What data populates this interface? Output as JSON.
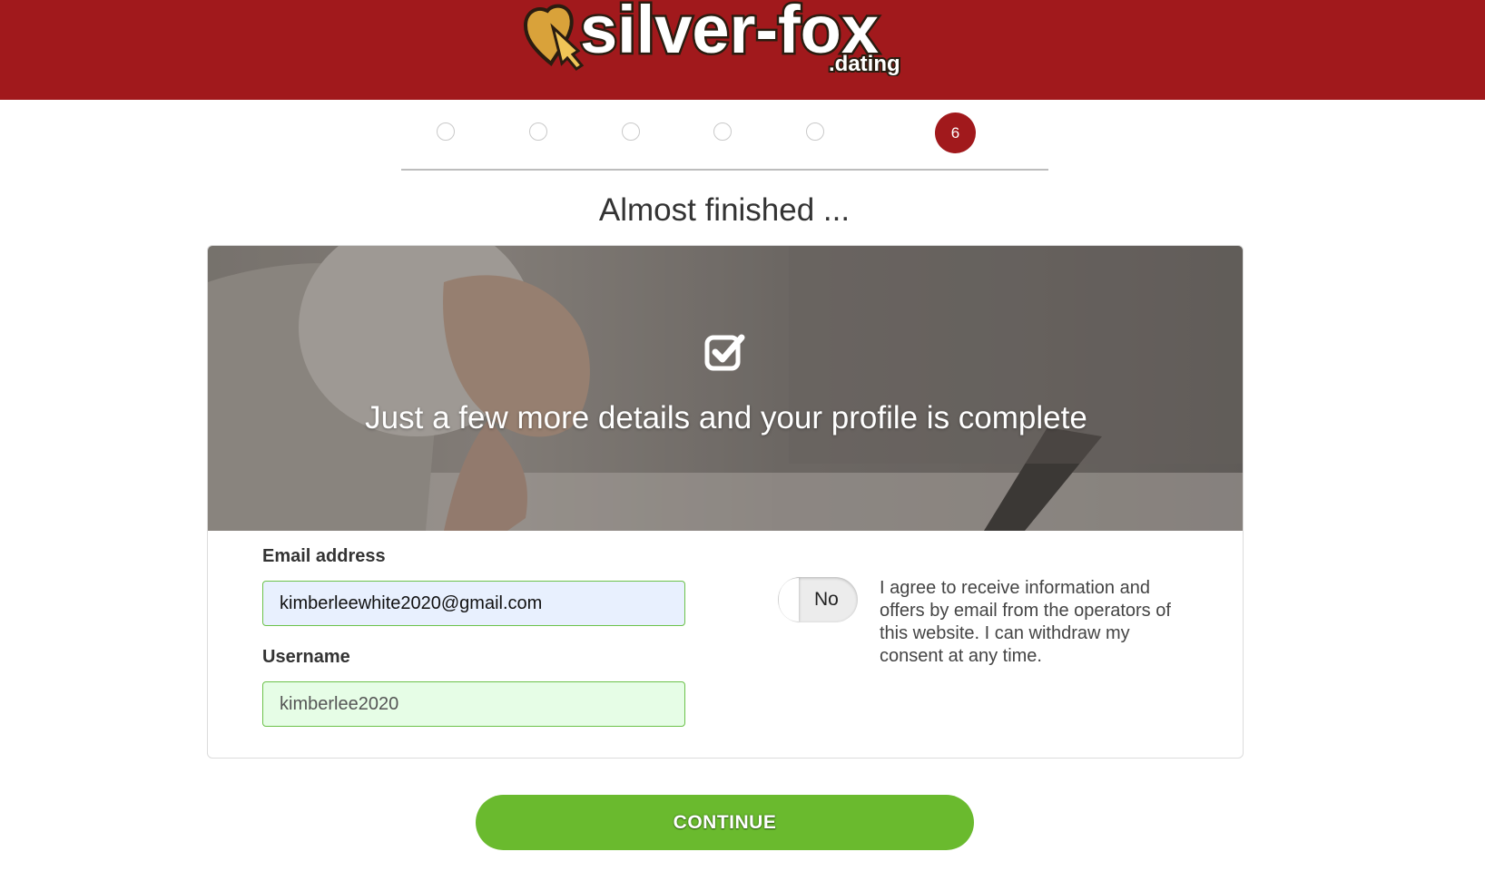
{
  "header": {
    "logo_main": "silver-fox",
    "logo_sub": ".dating",
    "background_color": "#a1191c"
  },
  "progress": {
    "current_step": "6",
    "total_steps": 6,
    "completed_steps": 5
  },
  "page": {
    "title": "Almost finished ..."
  },
  "hero": {
    "icon": "checkbox-check-icon",
    "text": "Just a few more details and your profile is complete"
  },
  "form": {
    "email_label": "Email address",
    "email_value": "kimberleewhite2020@gmail.com",
    "username_label": "Username",
    "username_value": "kimberlee2020",
    "consent_toggle_label": "No",
    "consent_text": "I agree to receive information and offers by email from the operators of this website. I can withdraw my consent at any time."
  },
  "actions": {
    "continue_label": "CONTINUE",
    "continue_color": "#6aba2e"
  }
}
